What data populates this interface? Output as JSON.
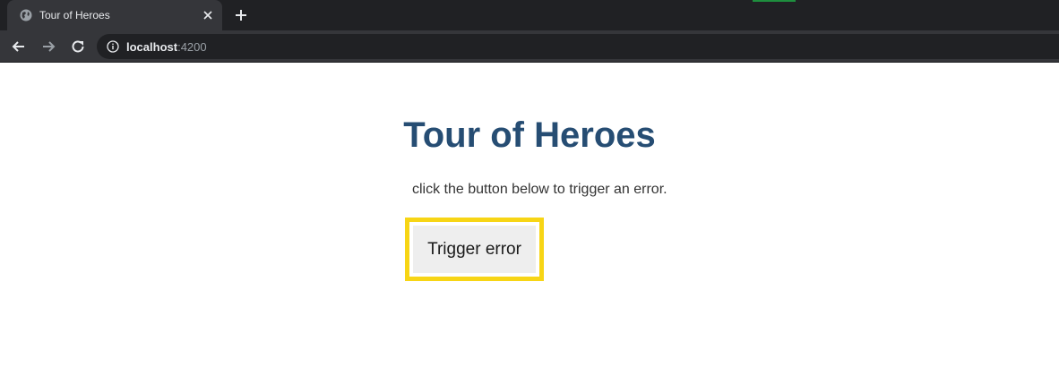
{
  "browser": {
    "tab_title": "Tour of Heroes",
    "url_host": "localhost",
    "url_port": ":4200",
    "colors": {
      "tabstrip": "#202124",
      "toolbar": "#35363a",
      "accent": "#1e8e3e"
    }
  },
  "page": {
    "title": "Tour of Heroes",
    "message": "click the button below to trigger an error.",
    "button_label": "Trigger error",
    "colors": {
      "title": "#264d73",
      "highlight": "#f7d515",
      "button_bg": "#eeeeee"
    }
  },
  "icons": [
    "globe-icon",
    "close-icon",
    "plus-icon",
    "back-arrow-icon",
    "forward-arrow-icon",
    "reload-icon",
    "info-icon"
  ]
}
